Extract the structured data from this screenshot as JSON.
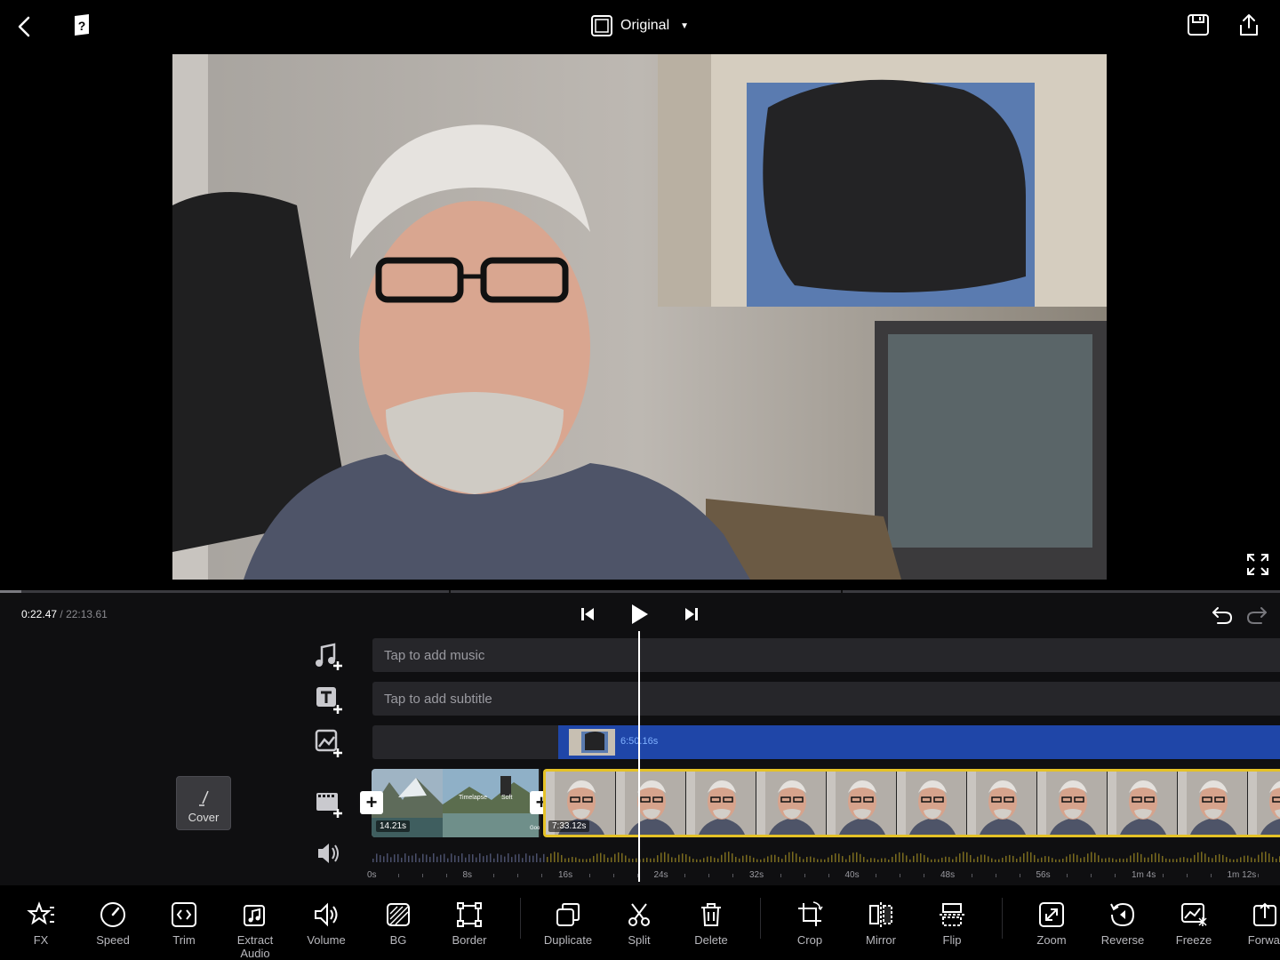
{
  "header": {
    "aspect_label": "Original"
  },
  "playback": {
    "current_time": "0:22.47",
    "separator": "/",
    "total_time": "22:13.61"
  },
  "timeline": {
    "music_hint": "Tap to add music",
    "subtitle_hint": "Tap to add subtitle",
    "overlay_duration": "6:50.16s",
    "clip_a_duration": "14.21s",
    "clip_b_caption_1": "Timelapse",
    "clip_b_caption_2": "Soft",
    "clip_b_caption_3": "Goo",
    "main_clip_duration": "7:33.12s",
    "cover_label": "Cover",
    "ruler": [
      "0s",
      "8s",
      "16s",
      "24s",
      "32s",
      "40s",
      "48s",
      "56s",
      "1m 4s",
      "1m 12s"
    ]
  },
  "toolbar": {
    "items": [
      {
        "id": "fx",
        "label": "FX",
        "icon": "star-sparkle-icon"
      },
      {
        "id": "speed",
        "label": "Speed",
        "icon": "speedometer-icon"
      },
      {
        "id": "trim",
        "label": "Trim",
        "icon": "trim-icon"
      },
      {
        "id": "extract-audio",
        "label": "Extract Audio",
        "icon": "extract-audio-icon"
      },
      {
        "id": "volume",
        "label": "Volume",
        "icon": "speaker-icon"
      },
      {
        "id": "bg",
        "label": "BG",
        "icon": "background-icon"
      },
      {
        "id": "border",
        "label": "Border",
        "icon": "border-icon"
      },
      {
        "id": "duplicate",
        "label": "Duplicate",
        "icon": "duplicate-icon"
      },
      {
        "id": "split",
        "label": "Split",
        "icon": "scissors-icon"
      },
      {
        "id": "delete",
        "label": "Delete",
        "icon": "trash-icon"
      },
      {
        "id": "crop",
        "label": "Crop",
        "icon": "crop-icon"
      },
      {
        "id": "mirror",
        "label": "Mirror",
        "icon": "mirror-icon"
      },
      {
        "id": "flip",
        "label": "Flip",
        "icon": "flip-icon"
      },
      {
        "id": "zoom",
        "label": "Zoom",
        "icon": "zoom-icon"
      },
      {
        "id": "reverse",
        "label": "Reverse",
        "icon": "reverse-icon"
      },
      {
        "id": "freeze",
        "label": "Freeze",
        "icon": "freeze-icon"
      },
      {
        "id": "forward",
        "label": "Forwar",
        "icon": "forward-icon"
      }
    ]
  },
  "colors": {
    "accent_yellow": "#e5c227",
    "overlay_blue": "#1f46a8",
    "background": "#0f0f11"
  },
  "progress": {
    "scrub_fraction": 0.017
  }
}
